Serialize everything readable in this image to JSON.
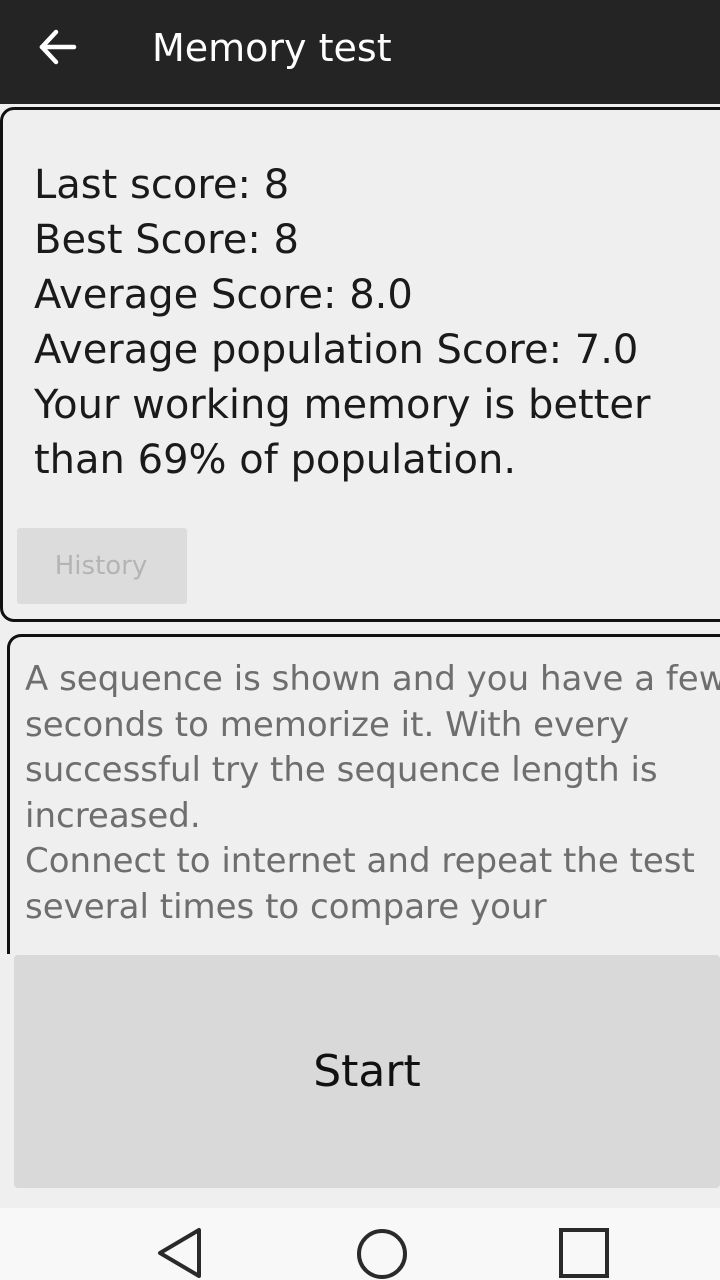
{
  "toolbar": {
    "title": "Memory test",
    "back_icon": "arrow-left-icon"
  },
  "scores": {
    "last": "Last score: 8",
    "best": "Best Score: 8",
    "average": "Average Score: 8.0",
    "population_average": "Average population Score: 7.0",
    "comparison": "Your working memory is better than 69% of population."
  },
  "history_button": "History",
  "description": {
    "lines": [
      "A sequence is shown and you have a few",
      "seconds to memorize it. With every",
      "successful try the sequence length is",
      "increased.",
      "Connect to internet and repeat the test",
      "several times to compare your"
    ]
  },
  "start_button": "Start",
  "nav": {
    "back_icon": "triangle-back-icon",
    "home_icon": "circle-home-icon",
    "recents_icon": "square-recents-icon"
  },
  "colors": {
    "toolbar_bg": "#242424",
    "page_bg": "#efefef",
    "button_bg": "#d9d9d9",
    "disabled_text": "#b4b4b4"
  }
}
